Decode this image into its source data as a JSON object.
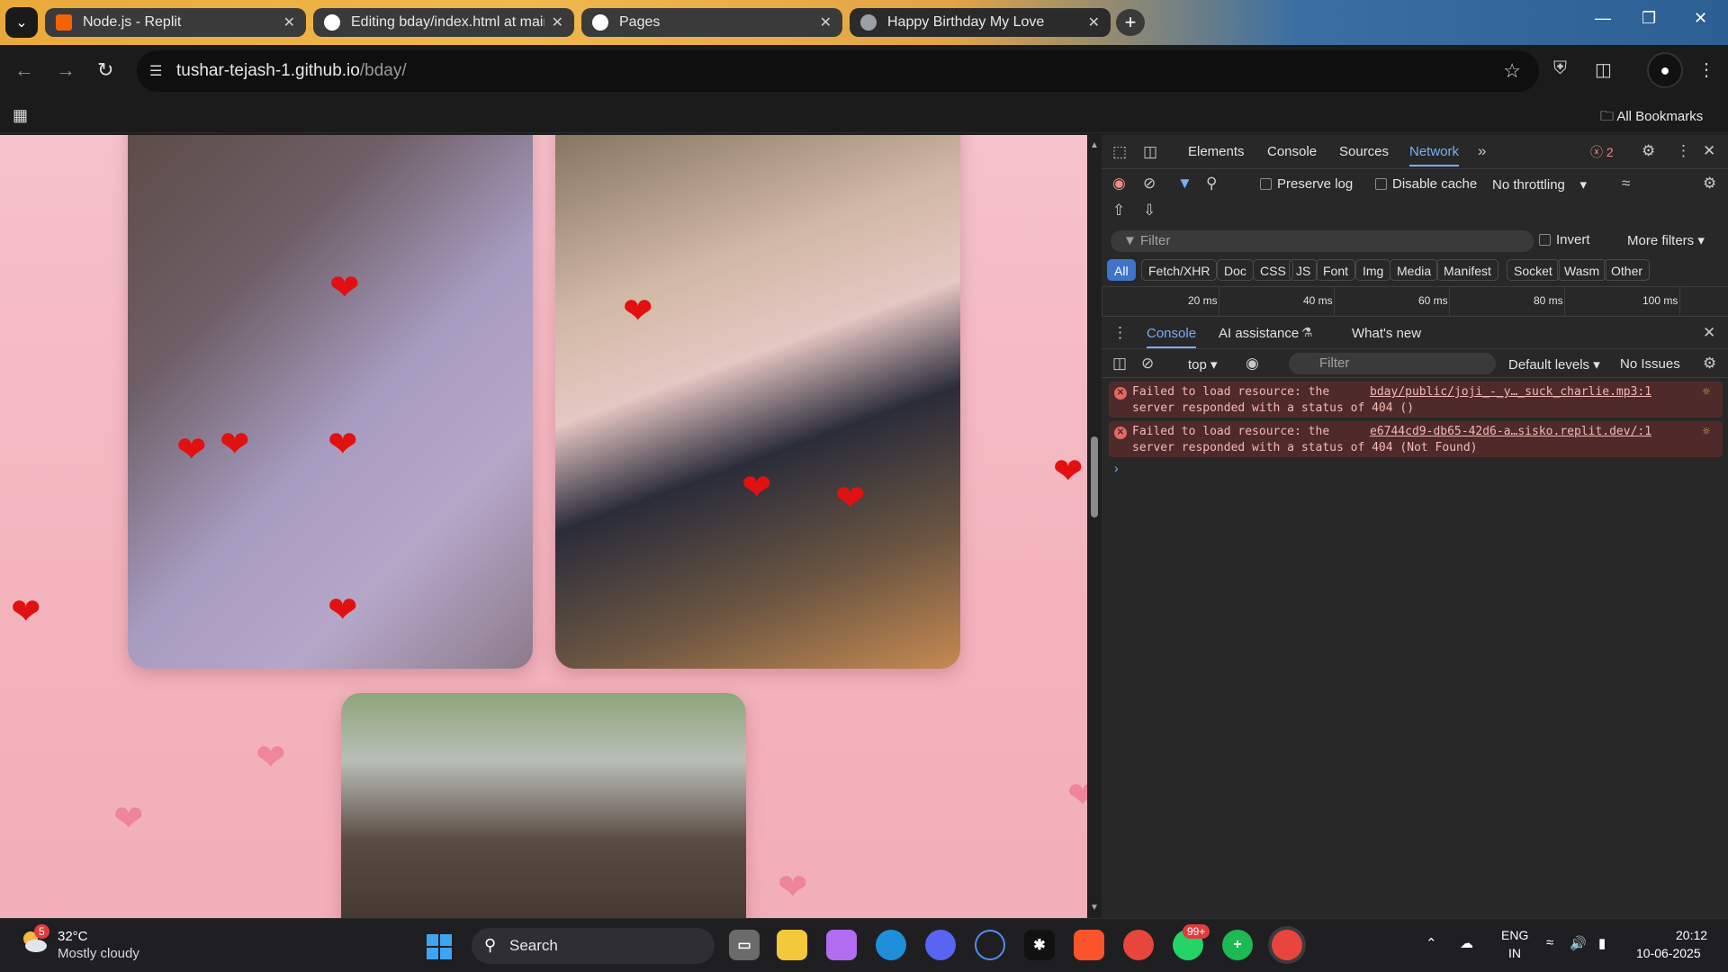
{
  "browser": {
    "tabs": [
      {
        "label": "Node.js - Replit",
        "icon_color": "#f26207"
      },
      {
        "label": "Editing bday/index.html at main",
        "icon_color": "#ffffff"
      },
      {
        "label": "Pages",
        "icon_color": "#ffffff"
      },
      {
        "label": "Happy Birthday My Love",
        "icon_color": "#9aa0a6"
      }
    ],
    "active_tab": 3,
    "url_host": "tushar-tejash-1.github.io",
    "url_path": "/bday/",
    "bookmarks_label": "All Bookmarks"
  },
  "devtools": {
    "tabs": [
      "Elements",
      "Console",
      "Sources",
      "Network"
    ],
    "active_tab": "Network",
    "error_count": "2",
    "network": {
      "preserve_log": "Preserve log",
      "disable_cache": "Disable cache",
      "throttling": "No throttling",
      "filter_placeholder": "Filter",
      "invert": "Invert",
      "more_filters": "More filters",
      "type_filters": [
        "All",
        "Fetch/XHR",
        "Doc",
        "CSS",
        "JS",
        "Font",
        "Img",
        "Media",
        "Manifest",
        "Socket",
        "Wasm",
        "Other"
      ],
      "timeline_ticks": [
        "20 ms",
        "40 ms",
        "60 ms",
        "80 ms",
        "100 ms"
      ]
    },
    "drawer": {
      "tabs": [
        "Console",
        "AI assistance",
        "What's new"
      ],
      "context": "top",
      "filter_placeholder": "Filter",
      "levels": "Default levels",
      "issues": "No Issues"
    },
    "messages": [
      {
        "line1": "Failed to load resource: the",
        "line2": "server responded with a status of 404 ()",
        "source": "bday/public/joji_-_y…_suck_charlie.mp3:1"
      },
      {
        "line1": "Failed to load resource: the",
        "line2": "server responded with a status of 404 (Not Found)",
        "source": "e6744cd9-db65-42d6-a…sisko.replit.dev/:1"
      }
    ]
  },
  "taskbar": {
    "weather_temp": "32°C",
    "weather_desc": "Mostly cloudy",
    "weather_badge": "5",
    "search_label": "Search",
    "whatsapp_badge": "99+",
    "lang_top": "ENG",
    "lang_bottom": "IN",
    "time": "20:12",
    "date": "10-06-2025"
  }
}
